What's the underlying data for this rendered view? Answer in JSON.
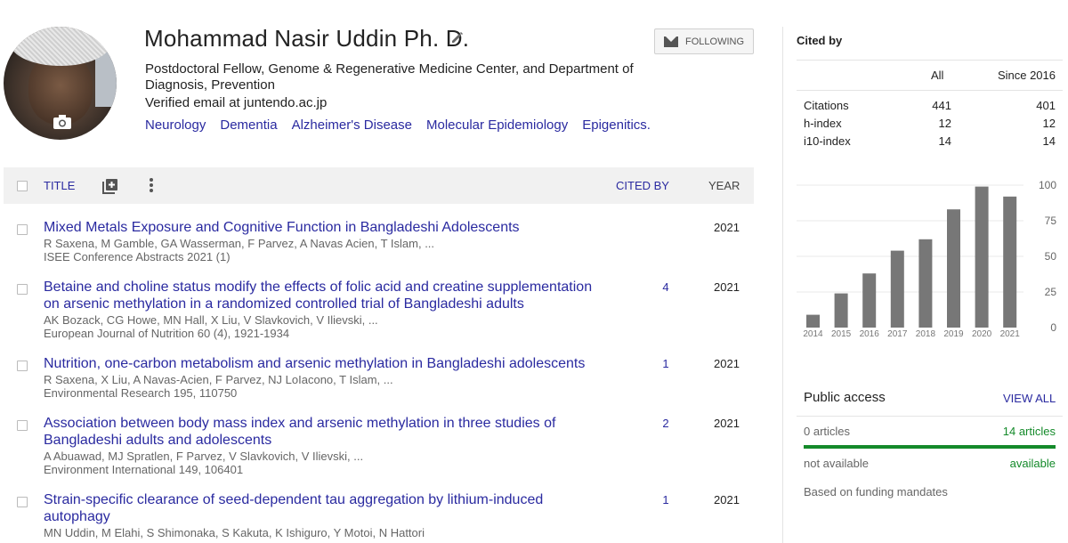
{
  "profile": {
    "name": "Mohammad Nasir Uddin Ph. D.",
    "affiliation": "Postdoctoral Fellow, Genome & Regenerative Medicine Center, and Department of Diagnosis, Prevention",
    "email": "Verified email at juntendo.ac.jp",
    "interests": [
      "Neurology",
      "Dementia",
      "Alzheimer's Disease",
      "Molecular Epidemiology",
      "Epigenitics."
    ],
    "follow_label": "FOLLOWING"
  },
  "table": {
    "title_header": "TITLE",
    "cited_header": "CITED BY",
    "year_header": "YEAR"
  },
  "articles": [
    {
      "title": "Mixed Metals Exposure and Cognitive Function in Bangladeshi Adolescents",
      "authors": "R Saxena, M Gamble, GA Wasserman, F Parvez, A Navas Acien, T Islam, ...",
      "venue": "ISEE Conference Abstracts 2021 (1)",
      "cited_by": "",
      "year": "2021"
    },
    {
      "title": "Betaine and choline status modify the effects of folic acid and creatine supplementation on arsenic methylation in a randomized controlled trial of Bangladeshi adults",
      "authors": "AK Bozack, CG Howe, MN Hall, X Liu, V Slavkovich, V Ilievski, ...",
      "venue": "European Journal of Nutrition 60 (4), 1921-1934",
      "cited_by": "4",
      "year": "2021"
    },
    {
      "title": "Nutrition, one-carbon metabolism and arsenic methylation in Bangladeshi adolescents",
      "authors": "R Saxena, X Liu, A Navas-Acien, F Parvez, NJ LoIacono, T Islam, ...",
      "venue": "Environmental Research 195, 110750",
      "cited_by": "1",
      "year": "2021"
    },
    {
      "title": "Association between body mass index and arsenic methylation in three studies of Bangladeshi adults and adolescents",
      "authors": "A Abuawad, MJ Spratlen, F Parvez, V Slavkovich, V Ilievski, ...",
      "venue": "Environment International 149, 106401",
      "cited_by": "2",
      "year": "2021"
    },
    {
      "title": "Strain-specific clearance of seed-dependent tau aggregation by lithium-induced autophagy",
      "authors": "MN Uddin, M Elahi, S Shimonaka, S Kakuta, K Ishiguro, Y Motoi, N Hattori",
      "venue": "",
      "cited_by": "1",
      "year": "2021"
    }
  ],
  "cited_by": {
    "title": "Cited by",
    "col_all": "All",
    "col_since": "Since 2016",
    "stats": [
      {
        "label": "Citations",
        "all": "441",
        "since": "401"
      },
      {
        "label": "h-index",
        "all": "12",
        "since": "12"
      },
      {
        "label": "i10-index",
        "all": "14",
        "since": "14"
      }
    ]
  },
  "chart_data": {
    "type": "bar",
    "categories": [
      "2014",
      "2015",
      "2016",
      "2017",
      "2018",
      "2019",
      "2020",
      "2021"
    ],
    "values": [
      9,
      24,
      38,
      54,
      62,
      83,
      99,
      92
    ],
    "yticks": [
      "100",
      "75",
      "50",
      "25",
      "0"
    ],
    "ylim": [
      0,
      100
    ],
    "bar_color": "#777777"
  },
  "public_access": {
    "title": "Public access",
    "view_all": "VIEW ALL",
    "left_count": "0 articles",
    "right_count": "14 articles",
    "left_status": "not available",
    "right_status": "available",
    "note": "Based on funding mandates",
    "accent_color": "#148a2a"
  }
}
